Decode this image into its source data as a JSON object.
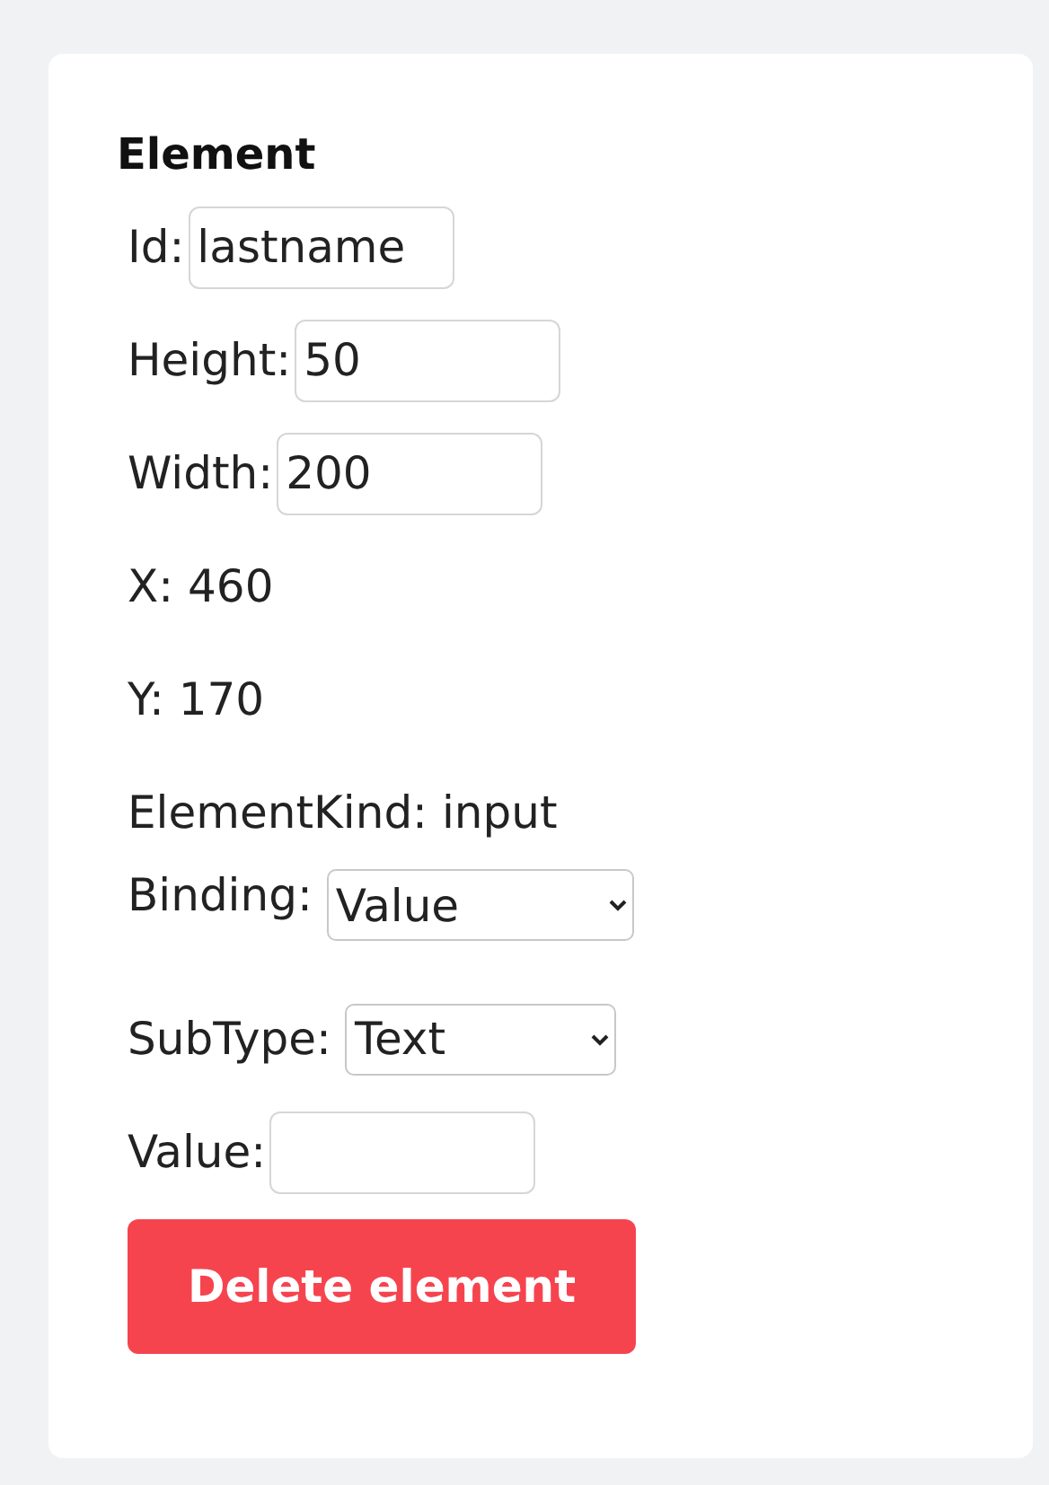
{
  "panel": {
    "title": "Element",
    "fields": [
      {
        "kind": "input",
        "label": "Id:",
        "value": "lastname"
      },
      {
        "kind": "input",
        "label": "Height:",
        "value": "50"
      },
      {
        "kind": "input",
        "label": "Width:",
        "value": "200"
      },
      {
        "kind": "text",
        "label": "X:",
        "value": "460"
      },
      {
        "kind": "text",
        "label": "Y:",
        "value": "170"
      },
      {
        "kind": "text",
        "label": "ElementKind:",
        "value": "input"
      },
      {
        "kind": "select",
        "label": "Binding:",
        "value": "Value"
      },
      {
        "kind": "select",
        "label": "SubType:",
        "value": "Text"
      },
      {
        "kind": "input",
        "label": "Value:"
      }
    ],
    "delete_button": "Delete element"
  }
}
